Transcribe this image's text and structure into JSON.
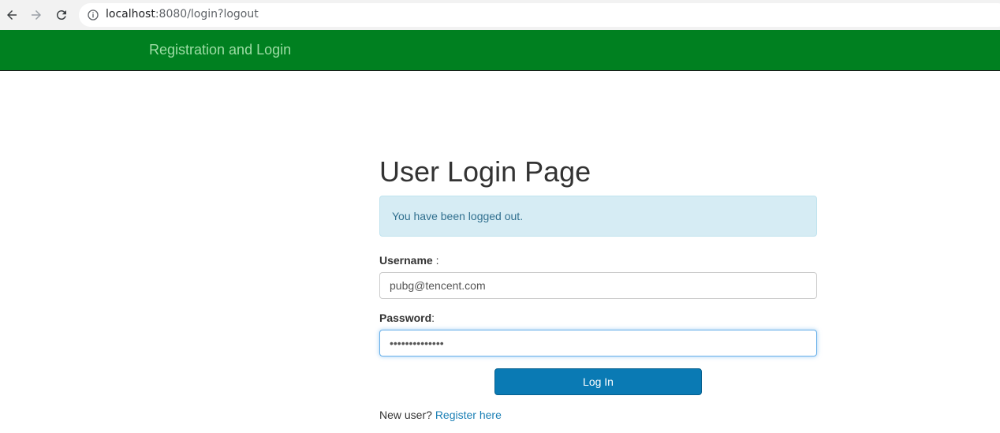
{
  "browser": {
    "url_host": "localhost",
    "url_rest": ":8080/login?logout"
  },
  "navbar": {
    "brand": "Registration and Login"
  },
  "page": {
    "title": "User Login Page",
    "alert": "You have been logged out.",
    "username_label": "Username",
    "username_suffix": " :",
    "username_value": "pubg@tencent.com",
    "password_label": "Password",
    "password_suffix": ":",
    "password_value": "••••••••••••••",
    "login_button": "Log In",
    "register_prompt": "New user? ",
    "register_link": "Register here"
  },
  "colors": {
    "navbar": "#008020",
    "alert_bg": "#d6ecf4",
    "button": "#0a7ab4"
  }
}
